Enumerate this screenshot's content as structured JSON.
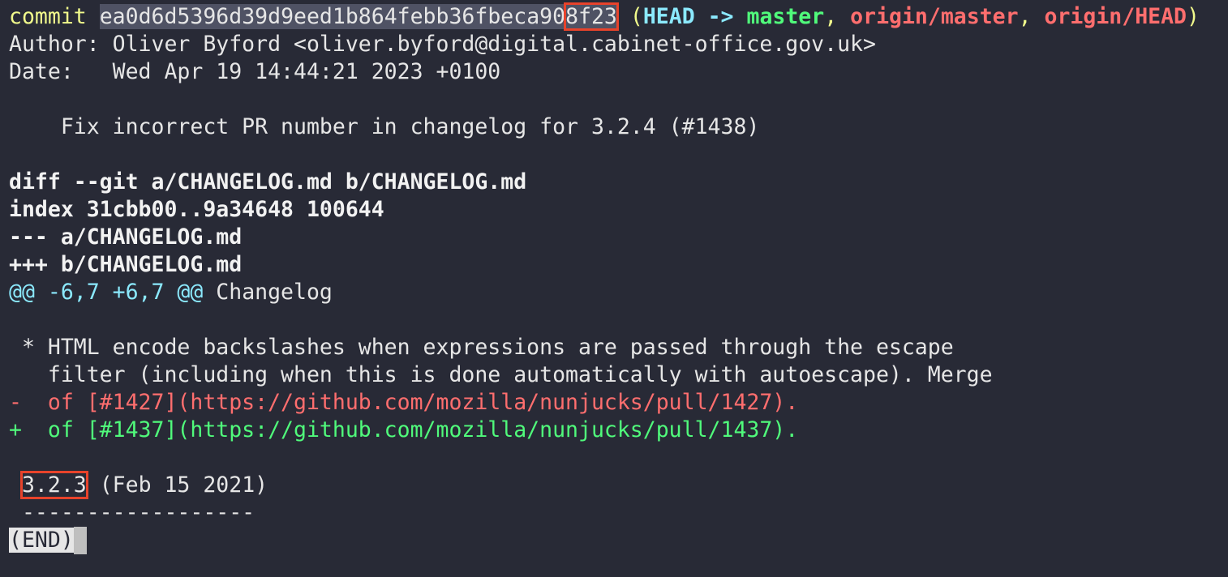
{
  "commit": {
    "keyword": "commit",
    "hash_main": "ea0d6d5396d39d9eed1b864febb36fbeca90",
    "hash_end": "8f23",
    "ref_open": "(",
    "head": "HEAD ->",
    "master": "master",
    "sep1": ",",
    "origin_master": "origin/master",
    "sep2": ",",
    "origin_head": "origin/HEAD",
    "ref_close": ")",
    "author_line": "Author: Oliver Byford <oliver.byford@digital.cabinet-office.gov.uk>",
    "date_line": "Date:   Wed Apr 19 14:44:21 2023 +0100",
    "message": "    Fix incorrect PR number in changelog for 3.2.4 (#1438)"
  },
  "diff": {
    "header": "diff --git a/CHANGELOG.md b/CHANGELOG.md",
    "index": "index 31cbb00..9a34648 100644",
    "minus_file": "--- a/CHANGELOG.md",
    "plus_file": "+++ b/CHANGELOG.md",
    "hunk_range": "@@ -6,7 +6,7 @@",
    "hunk_context": " Changelog",
    "context1": " * HTML encode backslashes when expressions are passed through the escape",
    "context2": "   filter (including when this is done automatically with autoescape). Merge",
    "removed": "-  of [#1427](https://github.com/mozilla/nunjucks/pull/1427).",
    "added": "+  of [#1437](https://github.com/mozilla/nunjucks/pull/1437).",
    "version": "3.2.3",
    "version_date": " (Feb 15 2021)",
    "underline": " ------------------"
  },
  "pager": {
    "end_label": "(END)"
  }
}
